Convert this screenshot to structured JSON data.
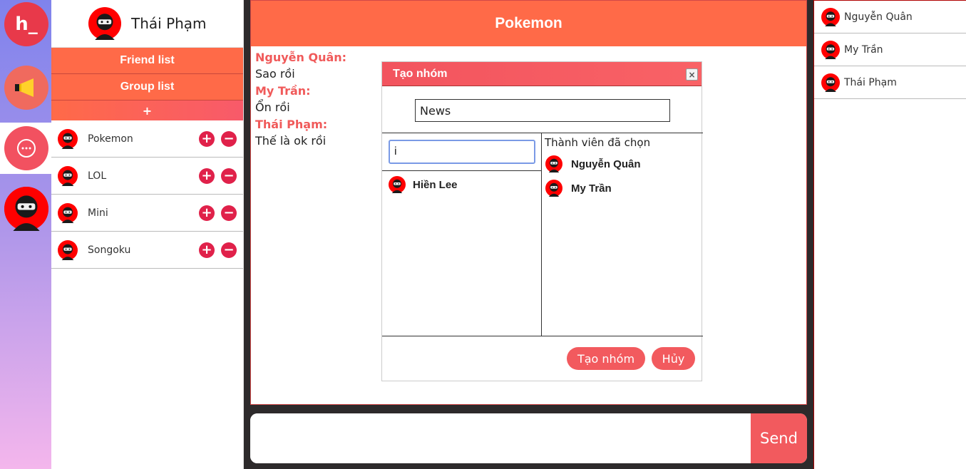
{
  "rail": {
    "logo_text": "h_"
  },
  "profile": {
    "name": "Thái Phạm"
  },
  "sidebar": {
    "tab_friends": "Friend list",
    "tab_groups": "Group list",
    "add_label": "+",
    "groups": [
      {
        "name": "Pokemon"
      },
      {
        "name": "LOL"
      },
      {
        "name": "Mini"
      },
      {
        "name": "Songoku"
      }
    ]
  },
  "chat": {
    "title": "Pokemon",
    "messages": [
      {
        "sender": "Nguyễn Quân:",
        "text": "Sao rồi"
      },
      {
        "sender": "My Trần:",
        "text": "Ổn rồi"
      },
      {
        "sender": "Thái Phạm:",
        "text": "Thế là ok rồi"
      }
    ],
    "input_value": "",
    "send_label": "Send"
  },
  "modal": {
    "title": "Tạo nhóm",
    "close_glyph": "×",
    "group_name_value": "News",
    "search_value": "i",
    "search_results": [
      {
        "name": "Hiền Lee"
      }
    ],
    "selected_title": "Thành viên đã chọn",
    "selected": [
      {
        "name": "Nguyễn Quân"
      },
      {
        "name": "My Trần"
      }
    ],
    "create_label": "Tạo nhóm",
    "cancel_label": "Hủy"
  },
  "online_users": [
    {
      "name": "Nguyễn Quân"
    },
    {
      "name": "My Trần"
    },
    {
      "name": "Thái Phạm"
    }
  ],
  "colors": {
    "accent": "#ff6a48",
    "button": "#f25a5e",
    "danger": "#e0214a"
  }
}
